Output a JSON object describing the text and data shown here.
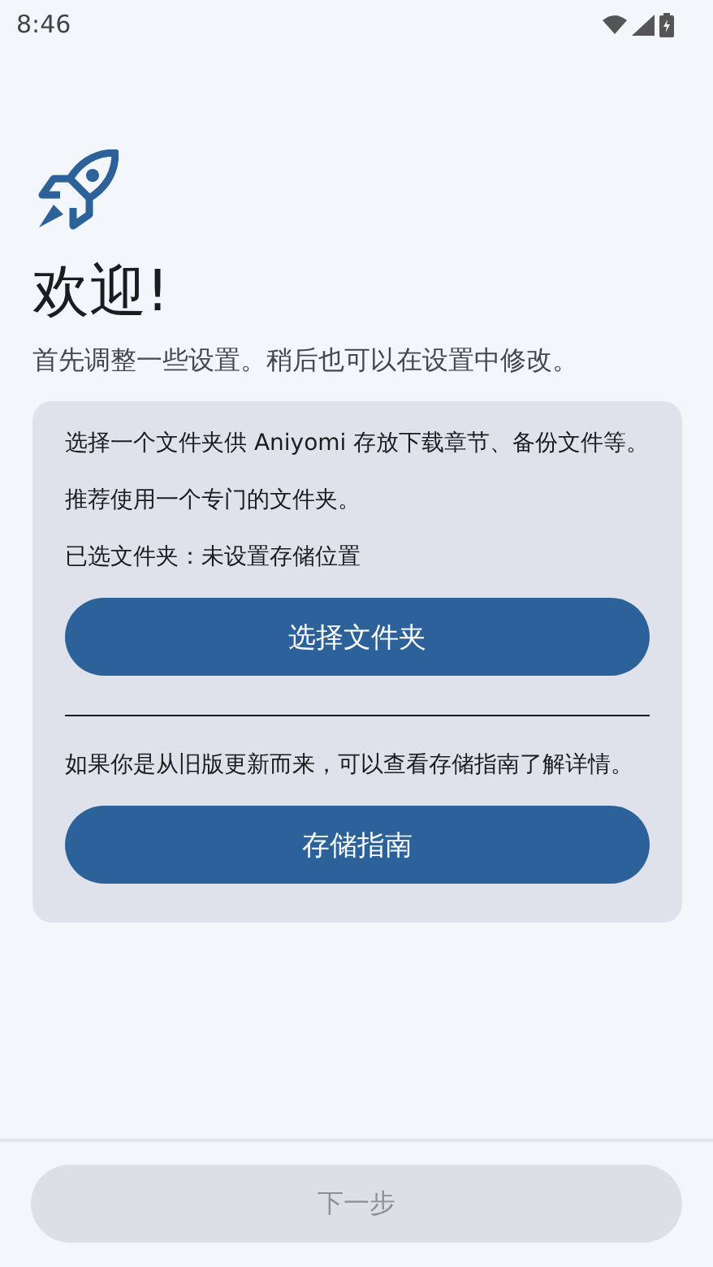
{
  "status_bar": {
    "time": "8:46"
  },
  "title": "欢迎!",
  "subtitle": "首先调整一些设置。稍后也可以在设置中修改。",
  "card": {
    "sections": [
      {
        "paragraphs": [
          "选择一个文件夹供 Aniyomi 存放下载章节、备份文件等。",
          "推荐使用一个专门的文件夹。",
          "已选文件夹：未设置存储位置"
        ],
        "button": "选择文件夹"
      },
      {
        "paragraphs": [
          "如果你是从旧版更新而来，可以查看存储指南了解详情。"
        ],
        "button": "存储指南"
      }
    ]
  },
  "next_button": {
    "label": "下一步",
    "disabled": true
  }
}
